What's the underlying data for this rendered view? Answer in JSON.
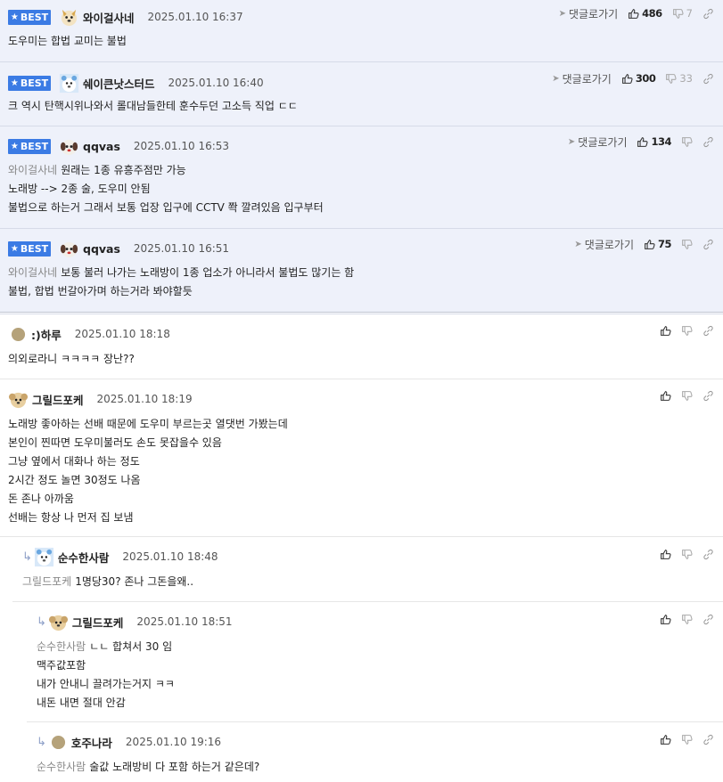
{
  "comments": [
    {
      "best": true,
      "badge": "BEST",
      "nick": "와이걸사네",
      "date": "2025.01.10 16:37",
      "goto": "댓글로가기",
      "likes": "486",
      "dislikes": "7",
      "avatar": "dog",
      "mention": "",
      "lines": [
        "도우미는 합법 교미는 불법"
      ]
    },
    {
      "best": true,
      "badge": "BEST",
      "nick": "쉐이큰낫스터드",
      "date": "2025.01.10 16:40",
      "goto": "댓글로가기",
      "likes": "300",
      "dislikes": "33",
      "avatar": "bear",
      "mention": "",
      "lines": [
        "크 역시 탄핵시위나와서 롤대남들한테 훈수두던 고소득 직업 ㄷㄷ"
      ]
    },
    {
      "best": true,
      "badge": "BEST",
      "nick": "qqvas",
      "date": "2025.01.10 16:53",
      "goto": "댓글로가기",
      "likes": "134",
      "dislikes": "",
      "avatar": "puppy",
      "mention": "와이걸사네",
      "lines": [
        "원래는 1종 유흥주점만 가능",
        "노래방 --> 2종 술, 도우미 안됨",
        "불법으로 하는거 그래서 보통 업장 입구에 CCTV 쫙 깔려있음 입구부터"
      ]
    },
    {
      "best": true,
      "badge": "BEST",
      "nick": "qqvas",
      "date": "2025.01.10 16:51",
      "goto": "댓글로가기",
      "likes": "75",
      "dislikes": "",
      "avatar": "puppy",
      "mention": "와이걸사네",
      "lines": [
        "보통 불러 나가는 노래방이 1종 업소가 아니라서 불법도 많기는 함",
        "불법, 합법 번갈아가며 하는거라 봐야할듯"
      ]
    },
    {
      "best": false,
      "nick": ":)하루",
      "date": "2025.01.10 18:18",
      "likes": "",
      "dislikes": "",
      "avatar": "dot",
      "mention": "",
      "lines": [
        "의외로라니 ㅋㅋㅋㅋ 장난??"
      ]
    },
    {
      "best": false,
      "nick": "그릴드포케",
      "date": "2025.01.10 18:19",
      "likes": "",
      "dislikes": "",
      "avatar": "poodle",
      "mention": "",
      "lines": [
        "노래방 좋아하는 선배 때문에 도우미 부르는곳 열댓번 가봤는데",
        "본인이 찐따면 도우미불러도 손도 못잡을수 있음",
        "그냥 옆에서 대화나 하는 정도",
        "2시간 정도 놀면 30정도 나옴",
        "돈 존나 아까움",
        "선배는 항상 나 먼저 집 보냄"
      ]
    },
    {
      "best": false,
      "nick": "순수한사람",
      "date": "2025.01.10 18:48",
      "likes": "",
      "dislikes": "",
      "avatar": "bear",
      "mention": "그릴드포케",
      "lines": [
        "1명당30? 존나 그돈을왜.."
      ]
    },
    {
      "best": false,
      "nick": "그릴드포케",
      "date": "2025.01.10 18:51",
      "likes": "",
      "dislikes": "",
      "avatar": "poodle",
      "mention": "순수한사람",
      "lines": [
        "ㄴㄴ 합쳐서 30 임",
        "맥주값포함",
        "내가 안내니 끌려가는거지 ㅋㅋ",
        "내돈 내면 절대 안감"
      ]
    },
    {
      "best": false,
      "nick": "호주나라",
      "date": "2025.01.10 19:16",
      "likes": "",
      "dislikes": "",
      "avatar": "dot",
      "mention": "순수한사람",
      "lines": [
        "술값 노래방비 다 포함 하는거 같은데?"
      ]
    }
  ],
  "icons": {
    "thumb_up": "thumb-up-icon",
    "thumb_down": "thumb-down-icon",
    "link": "link-icon",
    "reply": "reply-arrow-icon",
    "goto": "paper-plane-icon",
    "star": "star-icon"
  },
  "colors": {
    "best_bg": "#eef1fa",
    "badge": "#3b7be4",
    "mention": "#888888"
  }
}
